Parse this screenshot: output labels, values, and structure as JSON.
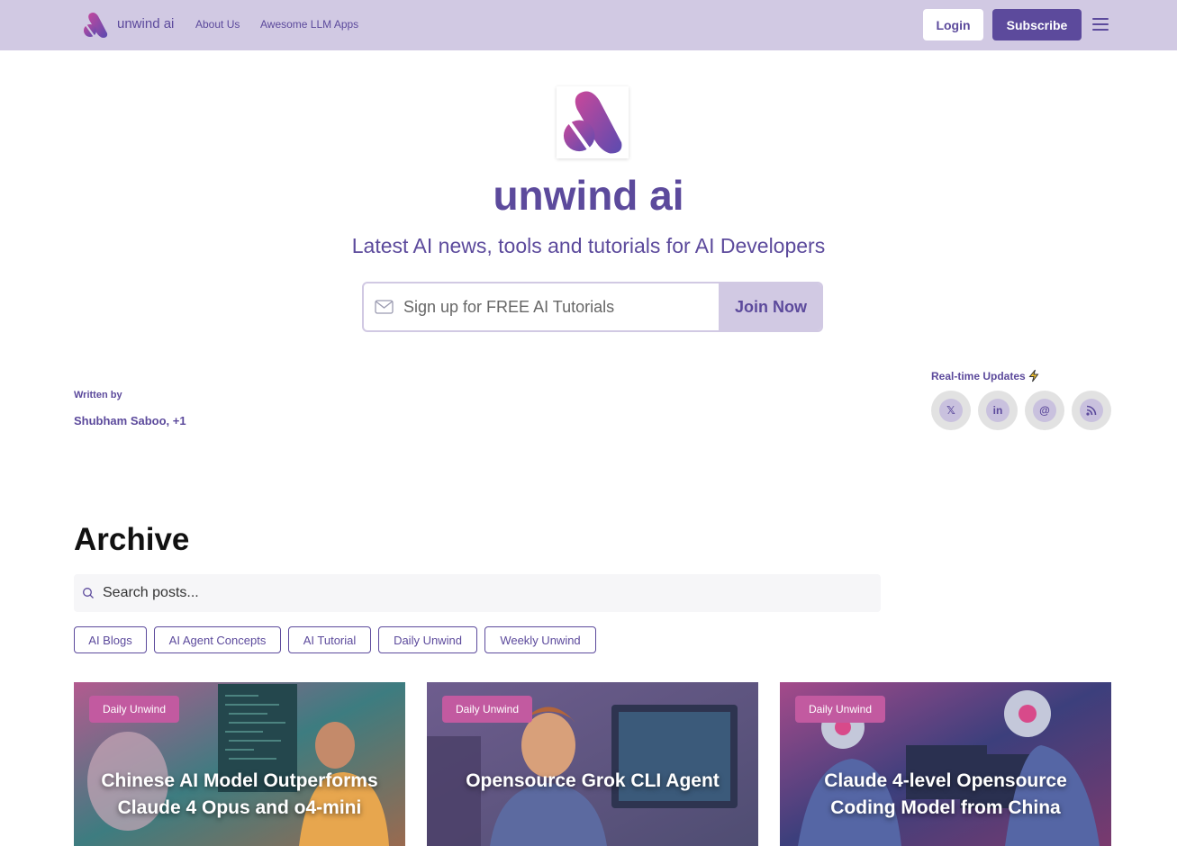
{
  "nav": {
    "brand": "unwind ai",
    "links": [
      "About Us",
      "Awesome LLM Apps"
    ],
    "login": "Login",
    "subscribe": "Subscribe"
  },
  "hero": {
    "title": "unwind ai",
    "subtitle": "Latest AI news, tools and tutorials for AI Developers",
    "signup_placeholder": "Sign up for FREE AI Tutorials",
    "signup_button": "Join Now"
  },
  "author": {
    "label": "Written by",
    "name": "Shubham Saboo, +1"
  },
  "social": {
    "label": "Real-time Updates",
    "icons": [
      "x-icon",
      "linkedin-icon",
      "threads-icon",
      "rss-icon"
    ]
  },
  "archive": {
    "title": "Archive",
    "search_placeholder": "Search posts...",
    "chips": [
      "AI Blogs",
      "AI Agent Concepts",
      "AI Tutorial",
      "Daily Unwind",
      "Weekly Unwind"
    ]
  },
  "cards": [
    {
      "badge": "Daily Unwind",
      "title": "Chinese AI Model Outperforms Claude 4 Opus and o4-mini"
    },
    {
      "badge": "Daily Unwind",
      "title": "Opensource Grok CLI Agent"
    },
    {
      "badge": "Daily Unwind",
      "title": "Claude 4-level Opensource Coding Model from China"
    }
  ],
  "colors": {
    "brand": "#5c4a9c",
    "nav_bg": "#d1c9e3",
    "badge": "#c25aa0"
  }
}
